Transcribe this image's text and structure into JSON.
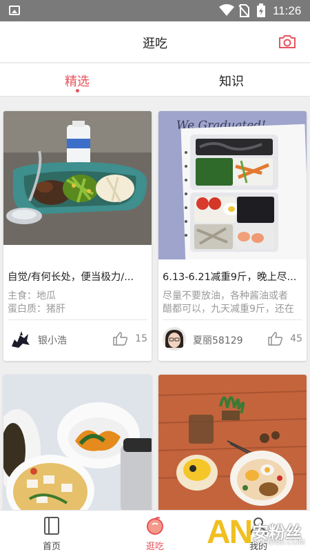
{
  "status_bar": {
    "time": "11:26",
    "icons": [
      "image-icon",
      "wifi-icon",
      "no-sim-icon",
      "battery-charging-icon"
    ]
  },
  "header": {
    "title": "逛吃",
    "camera_icon": "camera-icon"
  },
  "tabs": [
    {
      "label": "精选",
      "active": true
    },
    {
      "label": "知识",
      "active": false
    }
  ],
  "feed": [
    {
      "title": "自觉/有何长处，便当极力/...",
      "desc": [
        "主食：地瓜",
        "蛋白质：猪肝"
      ],
      "author": "银小浩",
      "likes": "15"
    },
    {
      "title": "6.13-6.21减重9斤，晚上尽...",
      "desc": [
        "尽量不要放油，各种酱油或者",
        "醋都可以，九天减重9斤，还在"
      ],
      "author": "夏丽58129",
      "likes": "45",
      "photo_text": "We Graduated!"
    },
    {
      "title": "",
      "desc": [],
      "author": "",
      "likes": ""
    },
    {
      "title": "",
      "desc": [],
      "author": "",
      "likes": ""
    }
  ],
  "bottom_nav": [
    {
      "label": "首页",
      "icon": "notebook-icon",
      "active": false
    },
    {
      "label": "逛吃",
      "icon": "orange-fruit-icon",
      "active": true
    },
    {
      "label": "我的",
      "icon": "user-icon",
      "active": false
    }
  ],
  "watermark": {
    "logo": "AN",
    "text": "安粉丝",
    "url": "ANFENSI.COM"
  },
  "colors": {
    "accent": "#e7525b",
    "status_bar": "#7a7a7a",
    "background": "#efefef"
  }
}
